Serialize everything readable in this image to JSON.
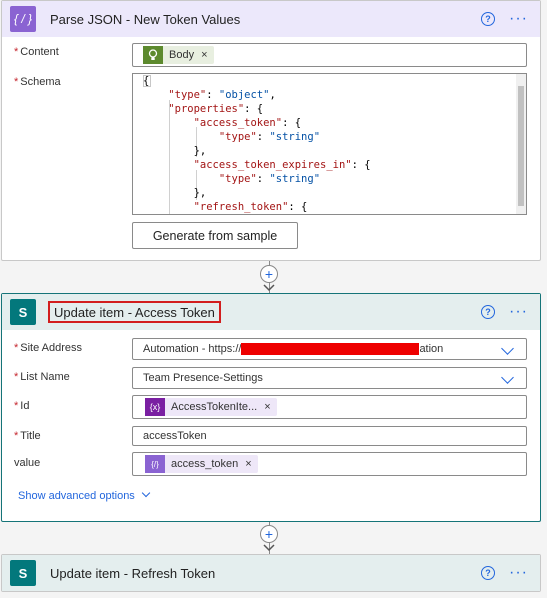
{
  "parse_json": {
    "title": "Parse JSON - New Token Values",
    "content_label": "Content",
    "content_token": "Body",
    "schema_label": "Schema",
    "schema_lines": [
      "{",
      "    \"type\": \"object\",",
      "    \"properties\": {",
      "        \"access_token\": {",
      "            \"type\": \"string\"",
      "        },",
      "        \"access_token_expires_in\": {",
      "            \"type\": \"string\"",
      "        },",
      "        \"refresh_token\": {"
    ],
    "generate_button": "Generate from sample"
  },
  "update_access": {
    "title": "Update item - Access Token",
    "site_address_label": "Site Address",
    "site_address_prefix": "Automation - https://",
    "site_address_suffix": "ation",
    "list_name_label": "List Name",
    "list_name_value": "Team Presence-Settings",
    "id_label": "Id",
    "id_token": "AccessTokenIte...",
    "title_label": "Title",
    "title_value": "accessToken",
    "value_label": "value",
    "value_token": "access_token",
    "show_advanced": "Show advanced options"
  },
  "update_refresh": {
    "title": "Update item - Refresh Token"
  },
  "required_marker": "*",
  "token_close": "×",
  "add_step": "+",
  "help_glyph": "?",
  "more_glyph": "···",
  "colors": {
    "parse_json_accent": "#8a63d2",
    "sharepoint_accent": "#03787c",
    "link_blue": "#2266dd",
    "highlight_red": "#d21e1e"
  },
  "icons": {
    "parse_json": "braces-icon",
    "sharepoint": "sharepoint-icon",
    "token_body": "bulb-icon",
    "token_variable": "variable-icon",
    "token_expression": "expression-icon"
  }
}
